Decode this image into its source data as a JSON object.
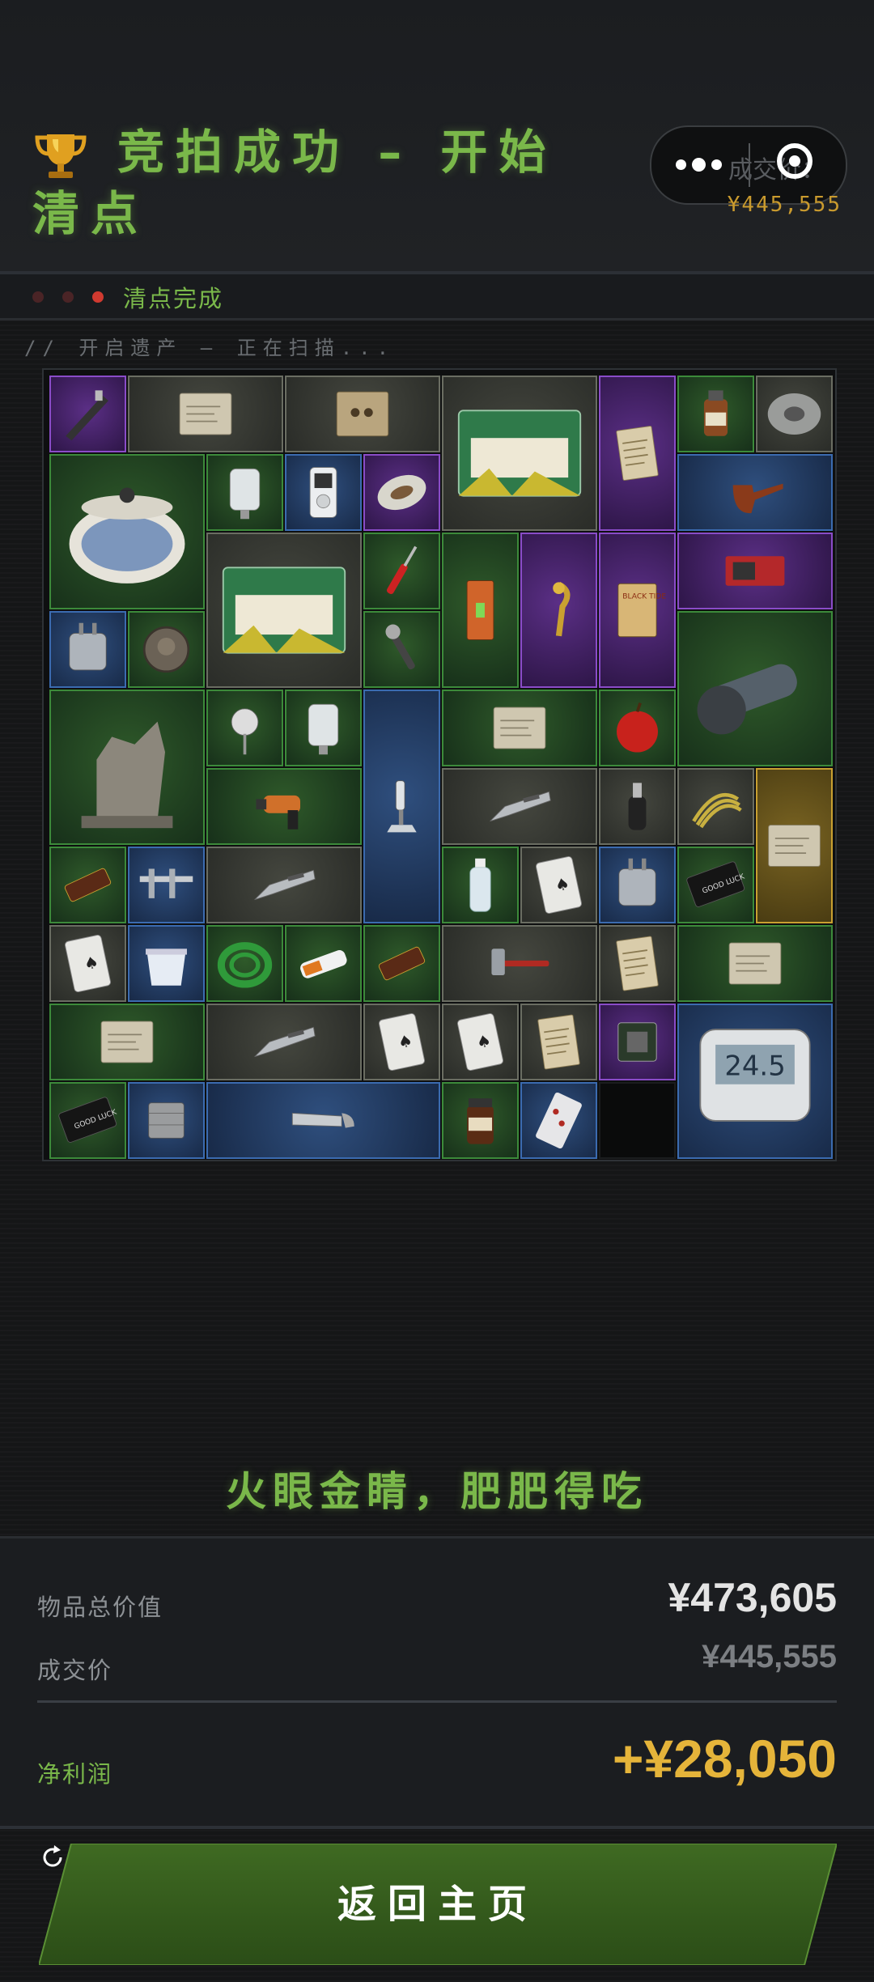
{
  "header": {
    "title": "竞拍成功 – 开始清点",
    "capsule_ghost_text": "成交价：",
    "deal_price_small": "¥445,555"
  },
  "status": {
    "text": "清点完成",
    "dot_colors": [
      "#4a2426",
      "#4a2426",
      "#d03a30"
    ]
  },
  "scan_label": "// 开启遗产 – 正在扫描...",
  "grid": {
    "rarity_colors": {
      "green": "#3c8a3a",
      "gray": "#6a6d62",
      "blue": "#3b6bb0",
      "purple": "#8a4cc8",
      "gold": "#c9a030"
    },
    "items": [
      {
        "name": "airbrush",
        "rarity": "purple"
      },
      {
        "name": "old-map",
        "rarity": "gray"
      },
      {
        "name": "old-family-photo",
        "rarity": "gray"
      },
      {
        "name": "emergency-candles-box",
        "rarity": "gray"
      },
      {
        "name": "old-documents",
        "rarity": "purple"
      },
      {
        "name": "medicine-bottle",
        "rarity": "green"
      },
      {
        "name": "duct-tape",
        "rarity": "gray"
      },
      {
        "name": "ceramic-pot",
        "rarity": "green"
      },
      {
        "name": "iv-bag",
        "rarity": "green"
      },
      {
        "name": "mp3-player",
        "rarity": "blue"
      },
      {
        "name": "football",
        "rarity": "purple"
      },
      {
        "name": "smoking-pipe",
        "rarity": "blue"
      },
      {
        "name": "emergency-candles-box-2",
        "rarity": "gray"
      },
      {
        "name": "screwdriver",
        "rarity": "green"
      },
      {
        "name": "spirit-level",
        "rarity": "green"
      },
      {
        "name": "brass-hook",
        "rarity": "purple"
      },
      {
        "name": "black-tide-book",
        "rarity": "purple"
      },
      {
        "name": "graphics-card",
        "rarity": "purple"
      },
      {
        "name": "power-adapter",
        "rarity": "blue"
      },
      {
        "name": "old-coin",
        "rarity": "green"
      },
      {
        "name": "wrench",
        "rarity": "green"
      },
      {
        "name": "angle-grinder",
        "rarity": "green"
      },
      {
        "name": "sphinx-statue",
        "rarity": "green"
      },
      {
        "name": "thermometer",
        "rarity": "green"
      },
      {
        "name": "iv-bag-2",
        "rarity": "green"
      },
      {
        "name": "microscope",
        "rarity": "blue"
      },
      {
        "name": "old-paper",
        "rarity": "green"
      },
      {
        "name": "apple",
        "rarity": "green"
      },
      {
        "name": "power-drill",
        "rarity": "green"
      },
      {
        "name": "utility-knife",
        "rarity": "gray"
      },
      {
        "name": "pepper-grinder",
        "rarity": "gray"
      },
      {
        "name": "rope",
        "rarity": "gray"
      },
      {
        "name": "blueprint",
        "rarity": "gold"
      },
      {
        "name": "chocolate-bar",
        "rarity": "green"
      },
      {
        "name": "caliper",
        "rarity": "blue"
      },
      {
        "name": "utility-knife-2",
        "rarity": "gray"
      },
      {
        "name": "water-bottle",
        "rarity": "green"
      },
      {
        "name": "playing-card",
        "rarity": "gray"
      },
      {
        "name": "power-adapter-2",
        "rarity": "blue"
      },
      {
        "name": "good-luck-card",
        "rarity": "green"
      },
      {
        "name": "playing-card-2",
        "rarity": "gray"
      },
      {
        "name": "yogurt-cup",
        "rarity": "blue"
      },
      {
        "name": "green-cable",
        "rarity": "green"
      },
      {
        "name": "battery",
        "rarity": "green"
      },
      {
        "name": "energy-bar",
        "rarity": "green"
      },
      {
        "name": "hammer",
        "rarity": "gray"
      },
      {
        "name": "receipt",
        "rarity": "gray"
      },
      {
        "name": "old-note",
        "rarity": "green"
      },
      {
        "name": "old-paper-2",
        "rarity": "green"
      },
      {
        "name": "utility-knife-3",
        "rarity": "gray"
      },
      {
        "name": "playing-card-3",
        "rarity": "gray"
      },
      {
        "name": "playing-card-4",
        "rarity": "gray"
      },
      {
        "name": "receipt-2",
        "rarity": "gray"
      },
      {
        "name": "circuit-chip",
        "rarity": "purple"
      },
      {
        "name": "digital-thermometer",
        "rarity": "blue"
      },
      {
        "name": "good-luck-card-2",
        "rarity": "green"
      },
      {
        "name": "metal-cube",
        "rarity": "blue"
      },
      {
        "name": "hand-saw",
        "rarity": "blue"
      },
      {
        "name": "instant-coffee",
        "rarity": "green"
      },
      {
        "name": "pill-blister",
        "rarity": "blue"
      },
      {
        "name": "empty-slot",
        "rarity": "empty"
      }
    ]
  },
  "slogan": "火眼金睛，肥肥得吃",
  "summary": {
    "total_label": "物品总价值",
    "total_value": "¥473,605",
    "deal_label": "成交价",
    "deal_value": "¥445,555",
    "profit_label": "净利润",
    "profit_value": "+¥28,050",
    "profit_color": "#e5b43a"
  },
  "button": {
    "label": "返回主页",
    "icon": "refresh-icon"
  }
}
